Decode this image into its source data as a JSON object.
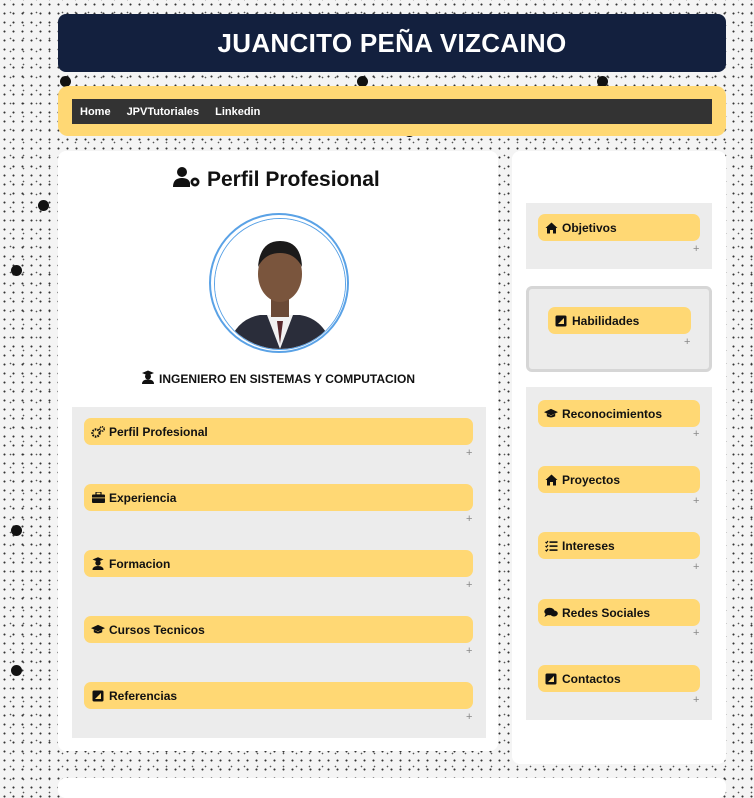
{
  "header": {
    "title": "JUANCITO PEÑA VIZCAINO"
  },
  "nav": {
    "items": [
      "Home",
      "JPVTutoriales",
      "Linkedin"
    ]
  },
  "profile": {
    "heading": "Perfil Profesional",
    "role": "INGENIERO EN SISTEMAS Y COMPUTACION",
    "photo_alt": "profile-photo"
  },
  "main_sections": [
    {
      "label": "Perfil Profesional",
      "icon": "gears-icon",
      "toggle": "+"
    },
    {
      "label": "Experiencia",
      "icon": "briefcase-icon",
      "toggle": "+"
    },
    {
      "label": "Formacion",
      "icon": "graduate-user-icon",
      "toggle": "+"
    },
    {
      "label": "Cursos Tecnicos",
      "icon": "graduation-cap-icon",
      "toggle": "+"
    },
    {
      "label": "Referencias",
      "icon": "address-book-icon",
      "toggle": "+"
    }
  ],
  "side_sections": [
    {
      "label": "Objetivos",
      "icon": "home-icon",
      "toggle": "+"
    },
    {
      "label": "Habilidades",
      "icon": "address-book-icon",
      "toggle": "+"
    },
    {
      "label": "Reconocimientos",
      "icon": "graduation-cap-icon",
      "toggle": "+"
    },
    {
      "label": "Proyectos",
      "icon": "home-icon",
      "toggle": "+"
    },
    {
      "label": "Intereses",
      "icon": "list-check-icon",
      "toggle": "+"
    },
    {
      "label": "Redes Sociales",
      "icon": "comments-icon",
      "toggle": "+"
    },
    {
      "label": "Contactos",
      "icon": "address-book-icon",
      "toggle": "+"
    }
  ],
  "colors": {
    "header_bg": "#13203e",
    "accent": "#ffd874",
    "panel": "#ececec",
    "avatar_border": "#5aa2e6"
  }
}
